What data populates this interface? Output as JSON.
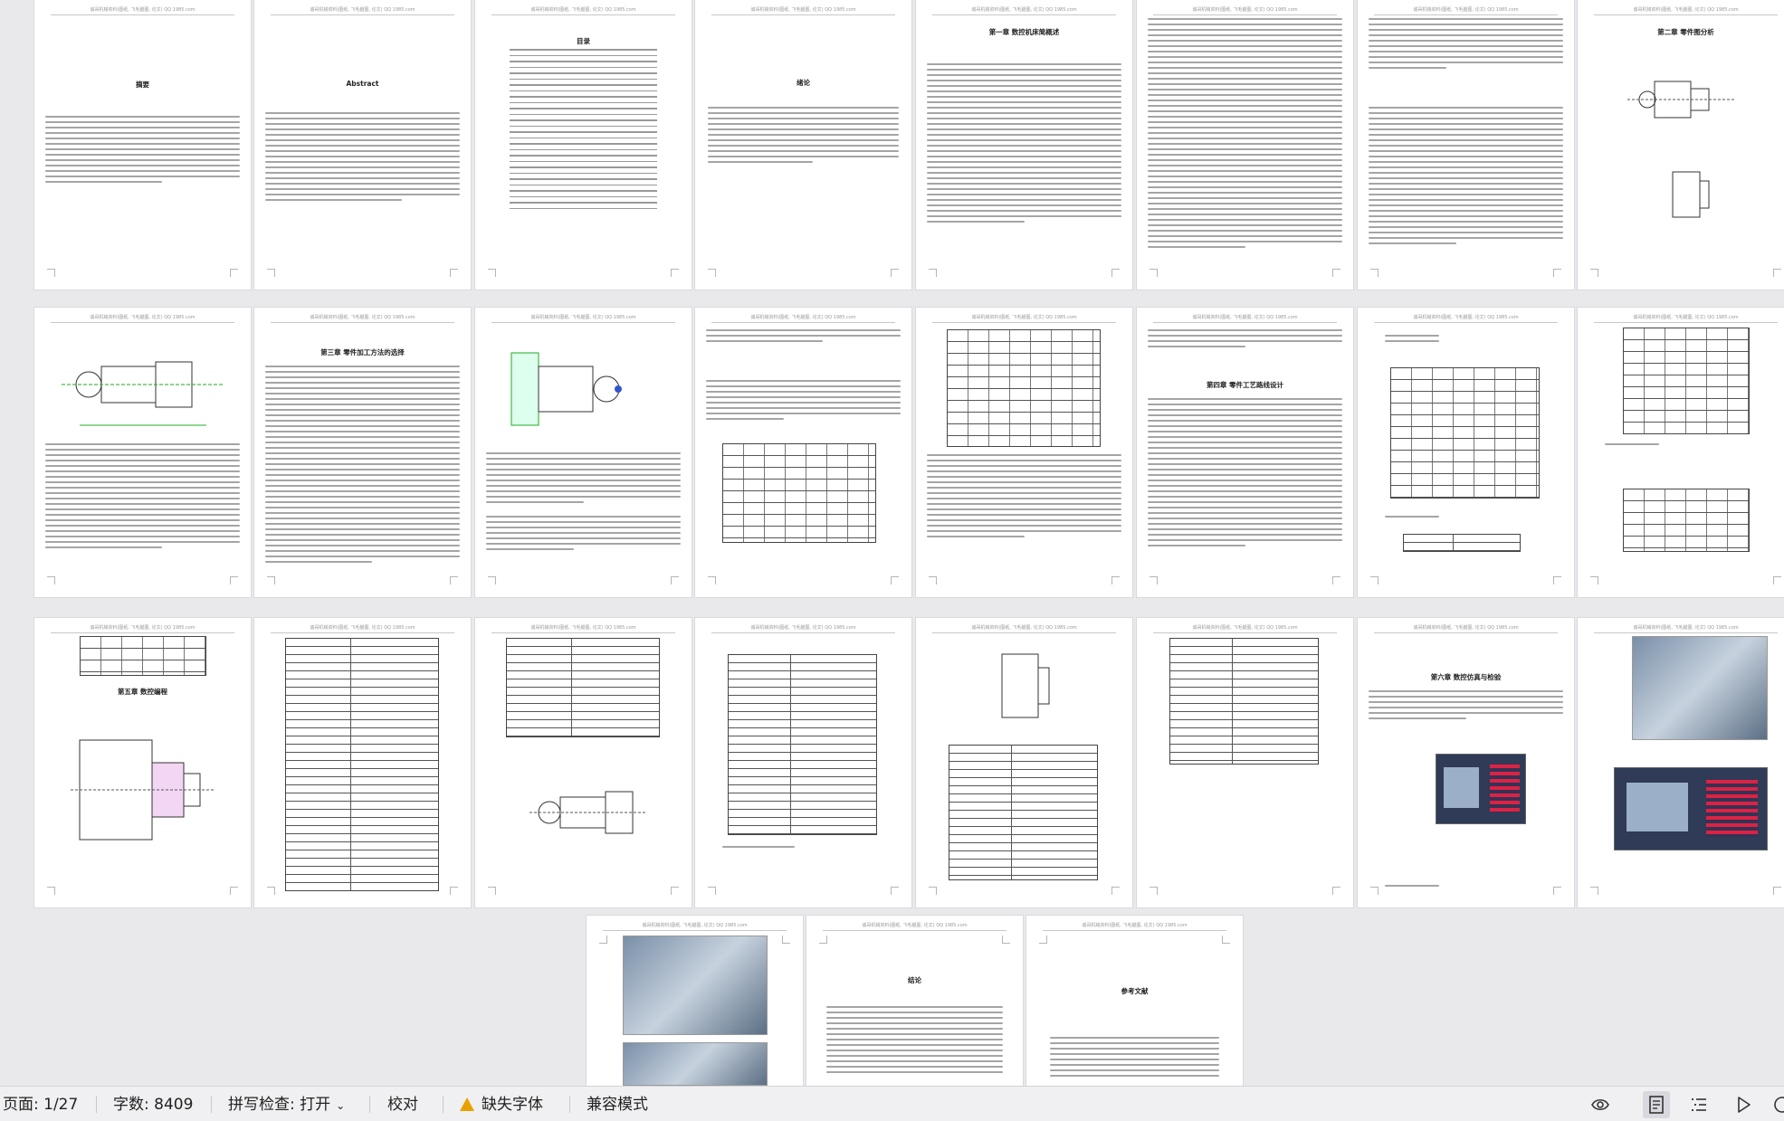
{
  "document": {
    "header_text": "诚哥机械资料(图纸, 飞毛腿图, 论文) QQ 1985.com",
    "pages": [
      {
        "title": "",
        "heading": "摘要"
      },
      {
        "title": "",
        "heading": "Abstract"
      },
      {
        "title": "",
        "heading": "目录"
      },
      {
        "title": "",
        "heading": "绪论"
      },
      {
        "title": "",
        "heading": "第一章 数控机床简概述"
      },
      {
        "title": "",
        "heading": ""
      },
      {
        "title": "",
        "heading": ""
      },
      {
        "title": "",
        "heading": "第二章 零件图分析"
      },
      {
        "title": "",
        "heading": ""
      },
      {
        "title": "",
        "heading": "第三章 零件加工方法的选择"
      },
      {
        "title": "",
        "heading": ""
      },
      {
        "title": "",
        "heading": ""
      },
      {
        "title": "",
        "heading": ""
      },
      {
        "title": "",
        "heading": "第四章 零件工艺路线设计"
      },
      {
        "title": "",
        "heading": ""
      },
      {
        "title": "",
        "heading": ""
      },
      {
        "title": "",
        "heading": "第五章 数控编程"
      },
      {
        "title": "",
        "heading": ""
      },
      {
        "title": "",
        "heading": ""
      },
      {
        "title": "",
        "heading": ""
      },
      {
        "title": "",
        "heading": ""
      },
      {
        "title": "",
        "heading": ""
      },
      {
        "title": "",
        "heading": "第六章 数控仿真与检验"
      },
      {
        "title": "",
        "heading": ""
      },
      {
        "title": "",
        "heading": ""
      },
      {
        "title": "",
        "heading": "结论"
      },
      {
        "title": "",
        "heading": "参考文献"
      }
    ]
  },
  "statusbar": {
    "page_indicator": "页面: 1/27",
    "word_count": "字数: 8409",
    "spell_check": "拼写检查: 打开",
    "proofread": "校对",
    "missing_fonts": "缺失字体",
    "compat_mode": "兼容模式"
  },
  "icons": {
    "menu": "grid-menu-icon",
    "eye": "eye-icon",
    "page_view": "page-view-icon",
    "outline": "outline-icon",
    "play": "play-icon",
    "web": "web-view-icon"
  },
  "colors": {
    "background": "#e9e9ec",
    "statusbar": "#f0f0f2",
    "warning": "#e8a200",
    "active_icon_bg": "#d8d8de"
  }
}
